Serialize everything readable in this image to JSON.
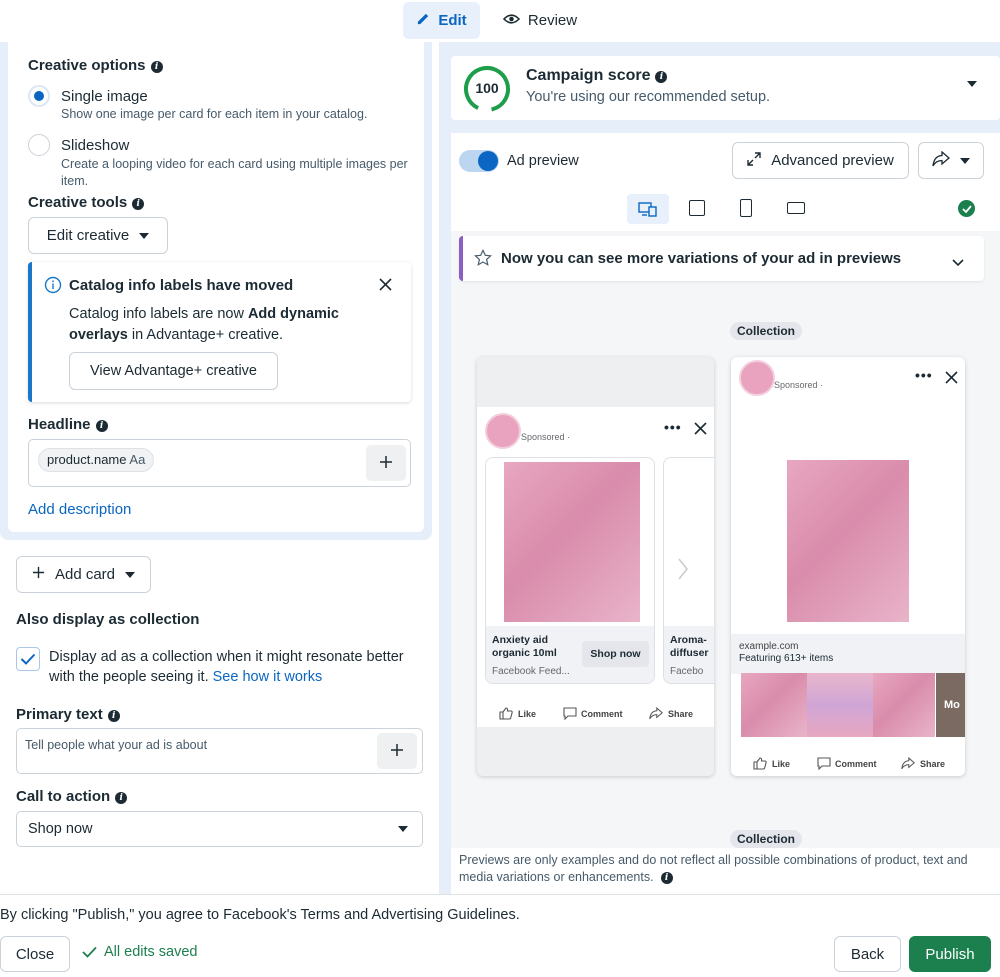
{
  "top_tabs": {
    "edit": "Edit",
    "review": "Review"
  },
  "creative_options": {
    "title": "Creative options",
    "single_image": {
      "label": "Single image",
      "desc": "Show one image per card for each item in your catalog."
    },
    "slideshow": {
      "label": "Slideshow",
      "desc": "Create a looping video for each card using multiple images per item."
    }
  },
  "creative_tools": {
    "title": "Creative tools",
    "edit_button": "Edit creative"
  },
  "notice": {
    "title": "Catalog info labels have moved",
    "body_pre": "Catalog info labels are now ",
    "body_bold": "Add dynamic overlays",
    "body_post": " in Advantage+ creative.",
    "button": "View Advantage+ creative"
  },
  "headline": {
    "title": "Headline",
    "token": "product.name",
    "token_suffix": "Aa"
  },
  "add_description": "Add description",
  "add_card": "Add card",
  "collection_section": {
    "title": "Also display as collection",
    "checkbox_text": "Display ad as a collection when it might resonate better with the people seeing it.",
    "link": "See how it works"
  },
  "primary_text": {
    "title": "Primary text",
    "placeholder": "Tell people what your ad is about"
  },
  "cta": {
    "title": "Call to action",
    "value": "Shop now"
  },
  "campaign_score": {
    "score": "100",
    "title": "Campaign score",
    "subtitle": "You're using our recommended setup."
  },
  "preview": {
    "toggle_label": "Ad preview",
    "advanced_button": "Advanced preview",
    "banner": "Now you can see more variations of your ad in previews",
    "collection_label": "Collection",
    "collection_label_2": "Collection",
    "sponsored": "Sponsored · ",
    "card1": {
      "title": "Anxiety aid organic 10ml",
      "cta": "Shop now",
      "source": "Facebook Feed..."
    },
    "card2": {
      "title": "Aroma-diffuser",
      "source": "Facebo"
    },
    "actions": {
      "like": "Like",
      "comment": "Comment",
      "share": "Share"
    },
    "collection": {
      "domain": "example.com",
      "featuring": "Featuring 613+ items",
      "more": "Mo"
    },
    "disclaimer": "Previews are only examples and do not reflect all possible combinations of product, text and media variations or enhancements."
  },
  "footer": {
    "terms_pre": "By clicking \"Publish,\" you agree to Facebook's ",
    "terms_link": "Terms and Advertising Guidelines",
    "terms_post": ".",
    "close": "Close",
    "saved": "All edits saved",
    "back": "Back",
    "publish": "Publish"
  },
  "colors": {
    "accent": "#0a66c2",
    "publish": "#1b7f4e",
    "score_ring": "#1e9e4a",
    "banner_bar": "#8b5fbf"
  }
}
